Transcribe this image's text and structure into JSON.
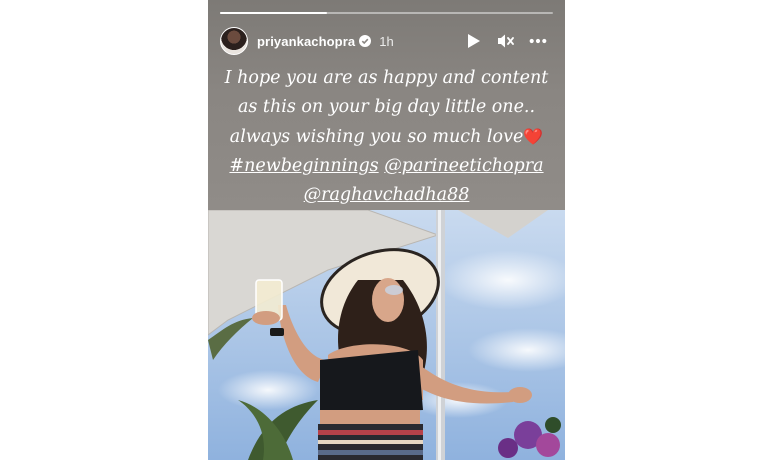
{
  "story": {
    "progress": 0.32,
    "user": {
      "username": "priyankachopra",
      "verified": true,
      "time_ago": "1h"
    },
    "controls": {
      "play_icon": "play-icon",
      "mute_icon": "mute-icon",
      "more_icon": "more-icon"
    },
    "caption": {
      "line1": "I hope you are as happy and content",
      "line2": "as this on your big day little one..",
      "line3": "always wishing you so much love",
      "heart": "❤️",
      "hashtag": "#newbeginnings",
      "mention1": "@parineetichopra",
      "mention2": "@raghavchadha88"
    },
    "colors": {
      "panel": "#8a8682",
      "heart": "#e0102a",
      "sky": "#a9c4e6"
    }
  }
}
